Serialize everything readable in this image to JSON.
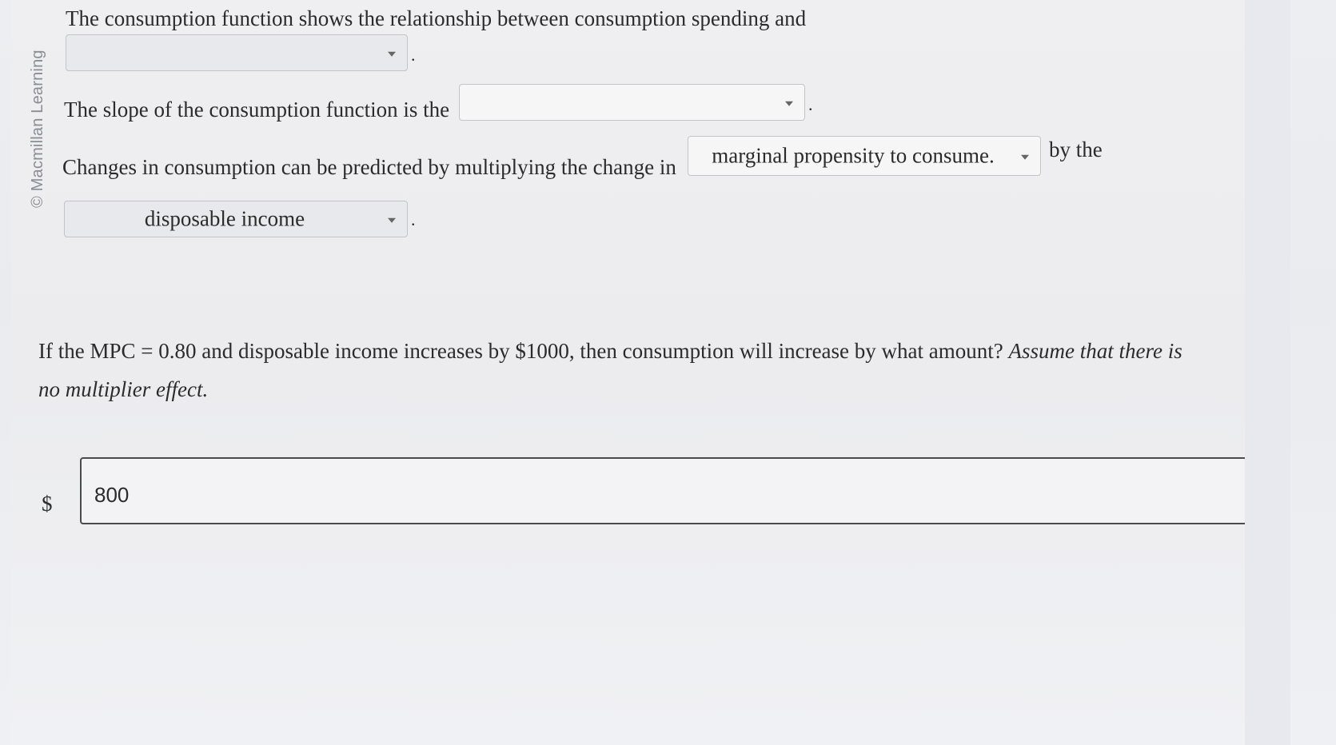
{
  "watermark": "© Macmillan Learning",
  "q1": {
    "text": "The consumption function shows the relationship between consumption spending and",
    "dropdown_value": "",
    "end": "."
  },
  "q2": {
    "text": "The slope of the consumption function is the",
    "dropdown_value": "",
    "end": "."
  },
  "q3": {
    "text_before": "Changes in consumption can be predicted by multiplying the change in",
    "dropdown1_value": "marginal propensity to consume.",
    "text_middle": "by the",
    "dropdown2_value": "disposable income",
    "end": "."
  },
  "question": {
    "text": "If the MPC = 0.80 and disposable income increases by $1000, then consumption will increase by what amount?",
    "italic": "Assume that there is no multiplier effect."
  },
  "answer": {
    "currency": "$",
    "value": "800"
  }
}
